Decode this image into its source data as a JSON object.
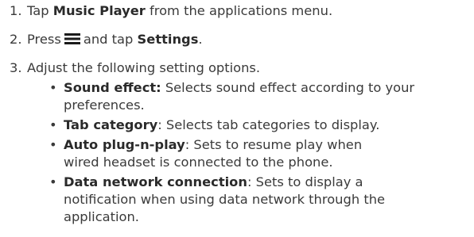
{
  "steps": [
    {
      "number": "1.",
      "pre": "Tap ",
      "bold": "Music Player",
      "post": " from the applications menu."
    },
    {
      "number": "2.",
      "pre": "Press",
      "icon": "menu-icon",
      "mid": "and tap ",
      "bold": "Settings",
      "post": "."
    },
    {
      "number": "3.",
      "text": "Adjust the following setting options."
    }
  ],
  "options": [
    {
      "bullet": "•",
      "label": "Sound effect:",
      "desc": " Selects sound effect according to your preferences."
    },
    {
      "bullet": "•",
      "label": "Tab category",
      "desc": ":  Selects tab categories to display."
    },
    {
      "bullet": "•",
      "label": "Auto plug-n-play",
      "desc": ": Sets to resume play when wired headset is connected to the phone."
    },
    {
      "bullet": "•",
      "label": "Data network connection",
      "desc": ": Sets to display a notification when using data network through the application."
    }
  ]
}
